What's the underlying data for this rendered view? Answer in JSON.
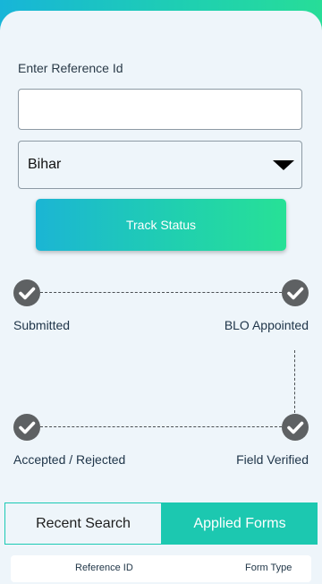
{
  "form": {
    "reference_label": "Enter Reference Id",
    "reference_value": "",
    "state_selected": "Bihar",
    "track_button": "Track Status"
  },
  "steps": [
    {
      "label": "Submitted",
      "status": "completed"
    },
    {
      "label": "BLO Appointed",
      "status": "completed"
    },
    {
      "label": "Accepted / Rejected",
      "status": "completed"
    },
    {
      "label": "Field Verified",
      "status": "completed"
    }
  ],
  "tabs": {
    "recent": "Recent Search",
    "applied": "Applied Forms",
    "active": "applied"
  },
  "table": {
    "columns": [
      "Reference ID",
      "Form Type"
    ]
  },
  "colors": {
    "accent": "#1cc8b0",
    "gradient_start": "#1bb5d4",
    "gradient_end": "#27e196",
    "step_icon": "#5e6163"
  },
  "icons": {
    "step": "check-circle-icon",
    "dropdown": "caret-down-icon"
  }
}
